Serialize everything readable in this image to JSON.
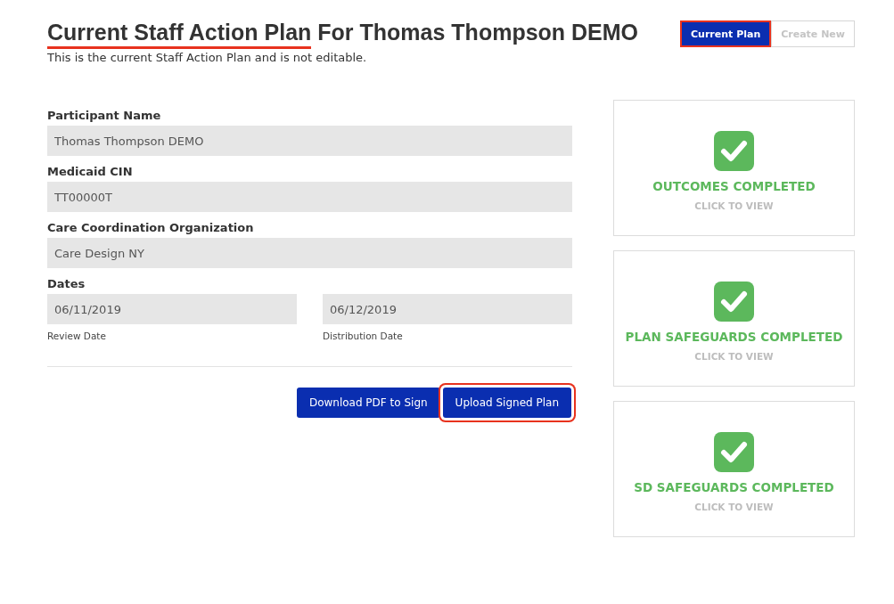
{
  "title_parts": [
    {
      "text": "Current Staff Action Plan",
      "annotated": true
    },
    {
      "text": "For Thomas Thompson DEMO",
      "annotated": false
    }
  ],
  "subtitle": "This is the current Staff Action Plan and is not editable.",
  "plan_toggle": [
    {
      "label": "Current Plan",
      "selected": true,
      "annotated": true
    },
    {
      "label": "Create New",
      "selected": false,
      "annotated": false
    }
  ],
  "fields": [
    {
      "label": "Participant Name",
      "value": "Thomas Thompson DEMO"
    },
    {
      "label": "Medicaid CIN",
      "value": "TT00000T"
    },
    {
      "label": "Care Coordination Organization",
      "value": "Care Design NY"
    }
  ],
  "dates": {
    "label": "Dates",
    "items": [
      {
        "value": "06/11/2019",
        "caption": "Review Date"
      },
      {
        "value": "06/12/2019",
        "caption": "Distribution Date"
      }
    ]
  },
  "actions": [
    {
      "label": "Download PDF to Sign",
      "annotated": false
    },
    {
      "label": "Upload Signed Plan",
      "annotated": true
    }
  ],
  "status_cards": [
    {
      "title": "OUTCOMES COMPLETED",
      "link": "CLICK TO VIEW",
      "completed": true
    },
    {
      "title": "PLAN SAFEGUARDS COMPLETED",
      "link": "CLICK TO VIEW",
      "completed": true
    },
    {
      "title": "SD SAFEGUARDS COMPLETED",
      "link": "CLICK TO VIEW",
      "completed": true
    }
  ]
}
